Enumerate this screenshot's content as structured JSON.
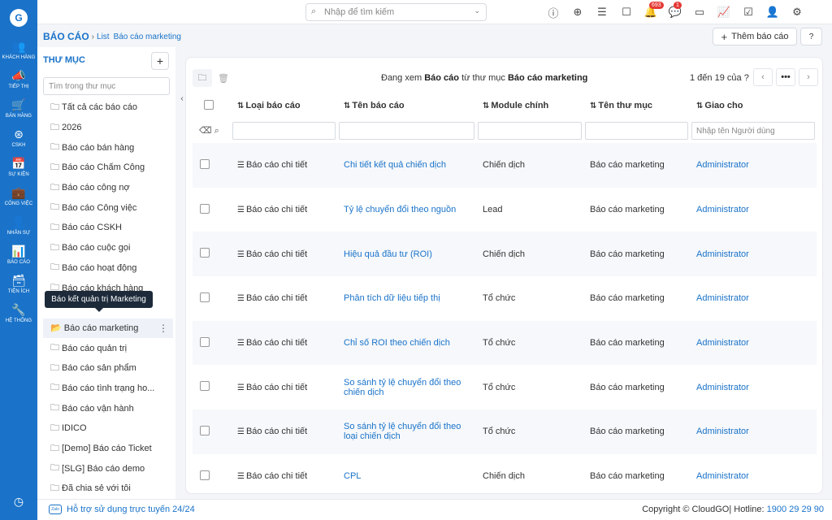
{
  "rail": {
    "logo": "G",
    "items": [
      {
        "label": "KHÁCH HÀNG",
        "icon": "users-icon",
        "glyph": "👥"
      },
      {
        "label": "TIẾP THỊ",
        "icon": "megaphone-icon",
        "glyph": "📣"
      },
      {
        "label": "BÁN HÀNG",
        "icon": "cart-icon",
        "glyph": "🛒"
      },
      {
        "label": "CSKH",
        "icon": "support-icon",
        "glyph": "⊛"
      },
      {
        "label": "SỰ KIỆN",
        "icon": "calendar-icon",
        "glyph": "📅"
      },
      {
        "label": "CÔNG VIỆC",
        "icon": "briefcase-icon",
        "glyph": "💼"
      },
      {
        "label": "NHÂN SỰ",
        "icon": "person-icon",
        "glyph": "👤"
      },
      {
        "label": "BÁO CÁO",
        "icon": "chart-icon",
        "glyph": "📊"
      },
      {
        "label": "TIỆN ÍCH",
        "icon": "box-icon",
        "glyph": "🗃"
      },
      {
        "label": "HỆ THỐNG",
        "icon": "wrench-icon",
        "glyph": "🔧"
      }
    ]
  },
  "topbar": {
    "search_placeholder": "Nhập để tìm kiếm",
    "notifications_count": "693",
    "messages_count": "1"
  },
  "breadcrumb": {
    "root": "BÁO CÁO",
    "level1": "List",
    "level2": "Báo cáo marketing"
  },
  "actions": {
    "add_report": "Thêm báo cáo"
  },
  "folders": {
    "title": "THƯ MỤC",
    "search_placeholder": "Tìm trong thư mục",
    "tooltip": "Báo kết quản trị Marketing",
    "items": [
      "Tất cả các báo cáo",
      "2026",
      "Báo cáo bán hàng",
      "Báo cáo Chấm Công",
      "Báo cáo công nợ",
      "Báo cáo Công việc",
      "Báo cáo CSKH",
      "Báo cáo cuộc gọi",
      "Báo cáo hoạt động",
      "Báo cáo khách hàng",
      "",
      "Báo cáo marketing",
      "Báo cáo quản trị",
      "Báo cáo sản phẩm",
      "Báo cáo tình trạng ho...",
      "Báo cáo vận hành",
      "IDICO",
      "[Demo] Báo cáo Ticket",
      "[SLG] Báo cáo demo",
      "Đã chia sẻ với tôi"
    ]
  },
  "main": {
    "viewing_prefix": "Đang xem",
    "viewing_module": "Báo cáo",
    "viewing_mid": "từ thư mục",
    "viewing_folder": "Báo cáo marketing",
    "pager": "1 đến 19 của",
    "pager_q": "?",
    "filter_placeholder_assignee": "Nhập tên Người dùng",
    "columns": [
      "Loại báo cáo",
      "Tên báo cáo",
      "Module chính",
      "Tên thư mục",
      "Giao cho"
    ],
    "rows": [
      {
        "type": "Báo cáo chi tiết",
        "name": "Chi tiết kết quả chiến dịch",
        "module": "Chiến dịch",
        "folder": "Báo cáo marketing",
        "assignee": "Administrator"
      },
      {
        "type": "Báo cáo chi tiết",
        "name": "Tỷ lệ chuyển đổi theo nguồn",
        "module": "Lead",
        "folder": "Báo cáo marketing",
        "assignee": "Administrator"
      },
      {
        "type": "Báo cáo chi tiết",
        "name": "Hiệu quả đầu tư (ROI)",
        "module": "Chiến dịch",
        "folder": "Báo cáo marketing",
        "assignee": "Administrator"
      },
      {
        "type": "Báo cáo chi tiết",
        "name": "Phân tích dữ liệu tiếp thị",
        "module": "Tổ chức",
        "folder": "Báo cáo marketing",
        "assignee": "Administrator"
      },
      {
        "type": "Báo cáo chi tiết",
        "name": "Chỉ số ROI theo chiến dịch",
        "module": "Tổ chức",
        "folder": "Báo cáo marketing",
        "assignee": "Administrator"
      },
      {
        "type": "Báo cáo chi tiết",
        "name": "So sánh tỷ lệ chuyển đổi theo chiến dịch",
        "module": "Tổ chức",
        "folder": "Báo cáo marketing",
        "assignee": "Administrator"
      },
      {
        "type": "Báo cáo chi tiết",
        "name": "So sánh tỷ lệ chuyển đổi theo loại chiến dịch",
        "module": "Tổ chức",
        "folder": "Báo cáo marketing",
        "assignee": "Administrator"
      },
      {
        "type": "Báo cáo chi tiết",
        "name": "CPL",
        "module": "Chiến dịch",
        "folder": "Báo cáo marketing",
        "assignee": "Administrator"
      }
    ]
  },
  "footer": {
    "support": "Hỗ trợ sử dụng trực tuyến 24/24",
    "zalo": "Zalo",
    "copyright": "Copyright © CloudGO",
    "hotline_label": "| Hotline:",
    "hotline": "1900 29 29 90"
  },
  "colors": {
    "primary": "#1a73c9",
    "badge": "#e53935",
    "tooltip": "#1c2a3a"
  }
}
